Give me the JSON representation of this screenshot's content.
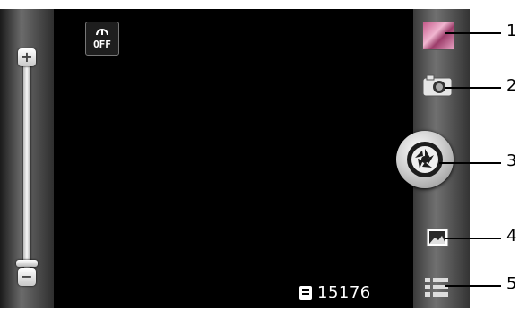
{
  "zoom": {
    "plus_label": "+",
    "minus_label": "−"
  },
  "viewfinder": {
    "timer_label": "OFF",
    "remaining_pictures": "15176"
  },
  "controls": {
    "icons": [
      "gallery-thumbnail",
      "camera-mode-icon",
      "shutter-button",
      "scene-mode-icon",
      "settings-menu-icon"
    ]
  },
  "callouts": [
    "1",
    "2",
    "3",
    "4",
    "5"
  ]
}
